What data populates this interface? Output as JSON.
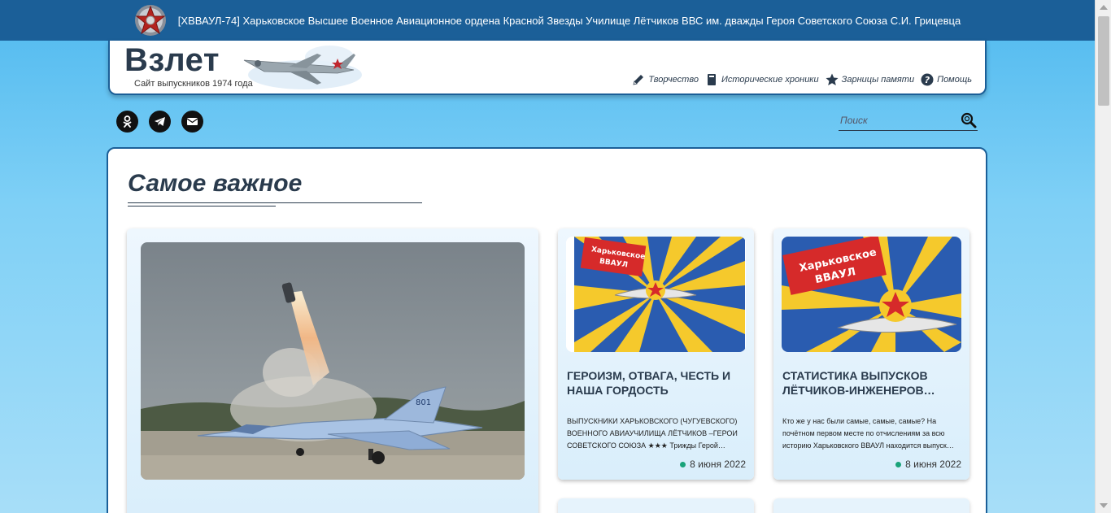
{
  "topbar": {
    "text": "[ХВВАУЛ-74] Харьковское Высшее Военное Авиационное ордена Красной Звезды Училище Лётчиков ВВС им. дважды Героя Советского Союза С.И. Грицевца",
    "icon": "red-star-icon"
  },
  "header": {
    "logo_title": "Взлет",
    "logo_subtitle": "Сайт выпускников 1974 года",
    "nav": [
      {
        "label": "Творчество",
        "icon": "pencil-icon"
      },
      {
        "label": "Исторические хроники",
        "icon": "book-icon"
      },
      {
        "label": "Зарницы памяти",
        "icon": "star-icon"
      },
      {
        "label": "Помощь",
        "icon": "question-icon"
      }
    ]
  },
  "socials": [
    {
      "name": "odnoklassniki",
      "icon": "odnoklassniki-icon"
    },
    {
      "name": "telegram",
      "icon": "telegram-icon"
    },
    {
      "name": "email",
      "icon": "envelope-icon"
    }
  ],
  "search": {
    "placeholder": "Поиск",
    "value": ""
  },
  "main": {
    "section_title": "Самое важное",
    "cards": [
      {
        "title": "Героизм, отвага, честь и наша гордость",
        "text": "ВЫПУСКНИКИ ХАРЬКОВСКОГО (ЧУГУЕВСКОГО) ВОЕННОГО АВИАУЧИЛИЩА ЛЁТЧИКОВ –ГЕРОИ СОВЕТСКОГО СОЮЗА ★★★ Трижды Герой…",
        "date": "8 июня 2022",
        "banner_text_1": "Харьковское",
        "banner_text_2": "ВВАУЛ"
      },
      {
        "title": "Статистика выпусков лётчиков-инженеров…",
        "text": " Кто же у нас были самые, самые, самые?      На почётном первом месте по отчислениям за всю историю Харьковского ВВАУЛ находится выпуск…",
        "date": "8 июня 2022",
        "banner_text_1": "Харьковское",
        "banner_text_2": "ВВАУЛ"
      }
    ],
    "jet_number": "801"
  },
  "colors": {
    "brand": "#1b5f98",
    "text_dark": "#2a3b4d",
    "date_dot": "#1aa37a"
  }
}
